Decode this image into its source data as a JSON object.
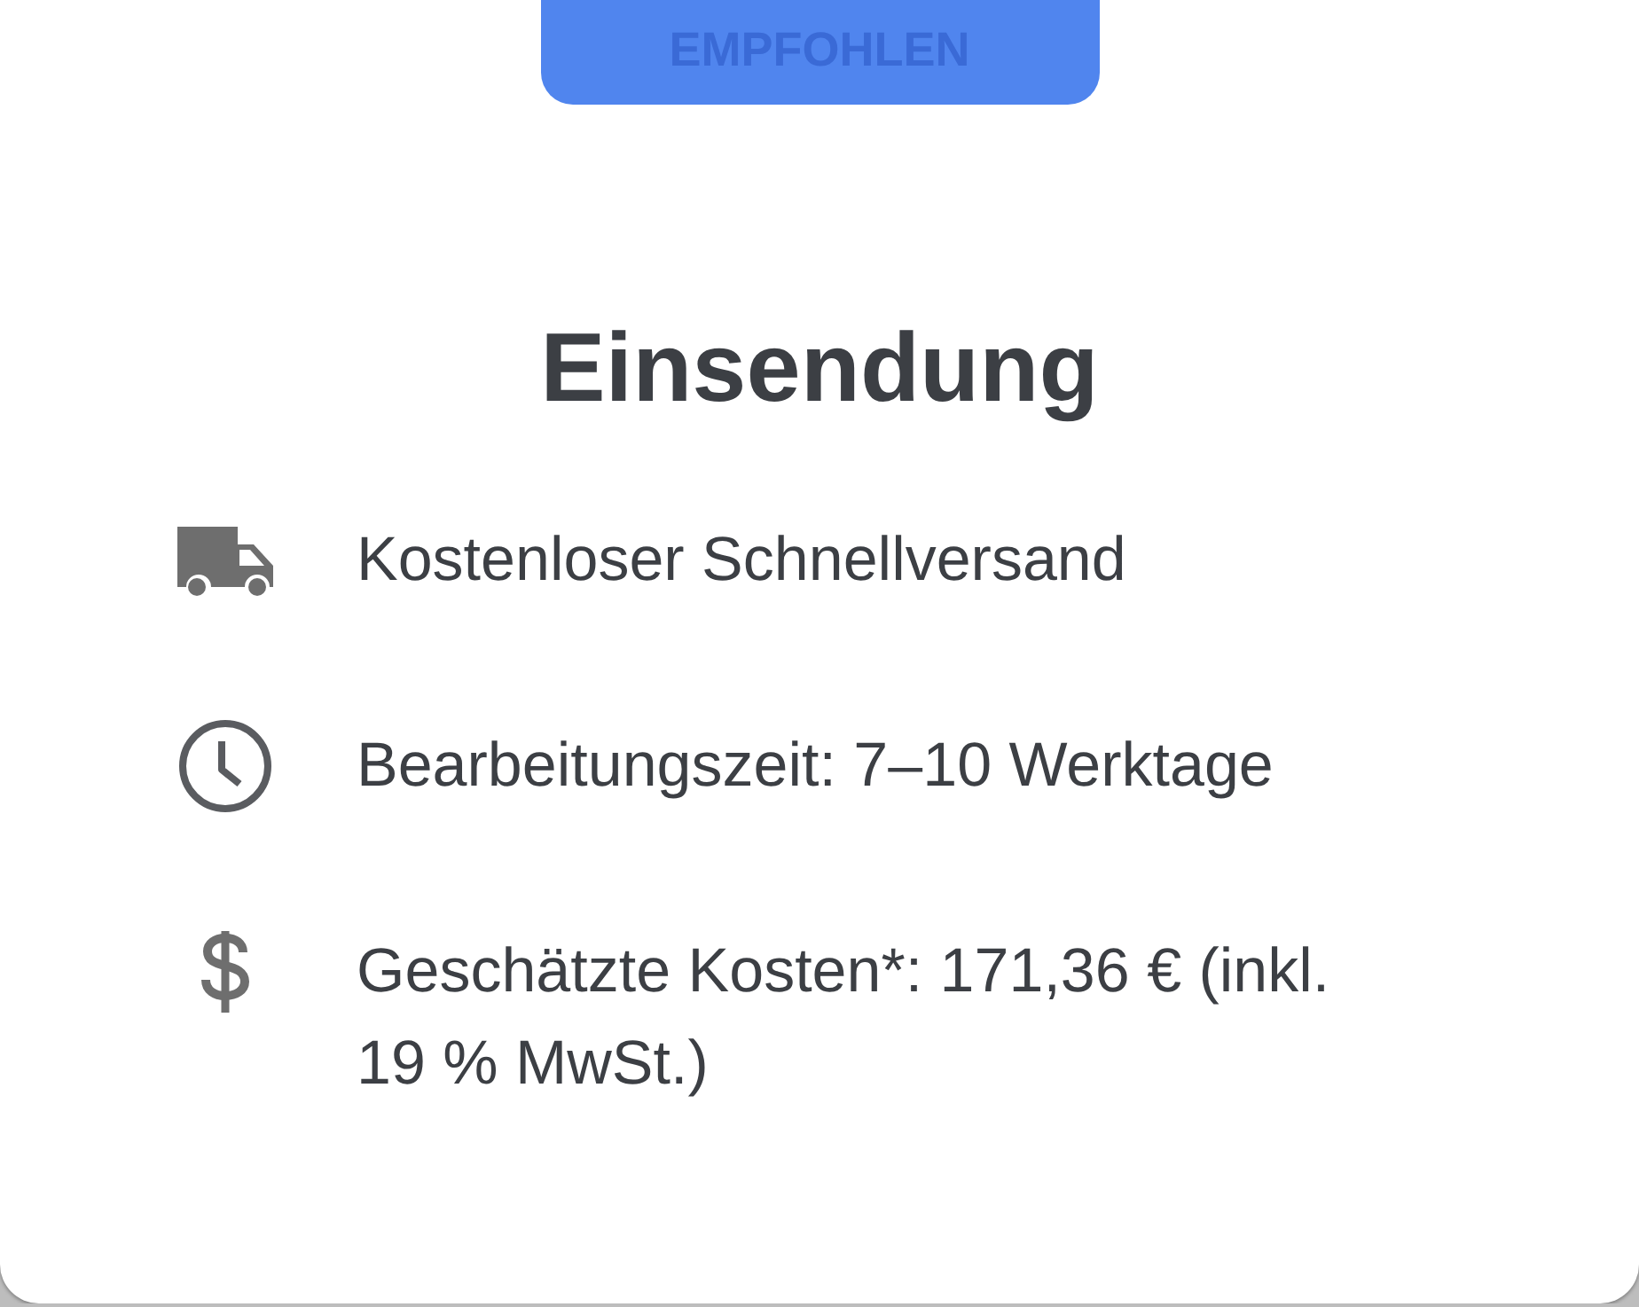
{
  "badge": {
    "label": "EMPFOHLEN"
  },
  "title": "Einsendung",
  "features": [
    {
      "kind": "truck",
      "text": "Kostenloser Schnellversand"
    },
    {
      "kind": "clock",
      "text": "Bearbeitungszeit: 7–10 Werktage"
    },
    {
      "kind": "dollar",
      "text": "Geschätzte Kosten*: 171,36 € (inkl. 19 % MwSt.)"
    }
  ]
}
